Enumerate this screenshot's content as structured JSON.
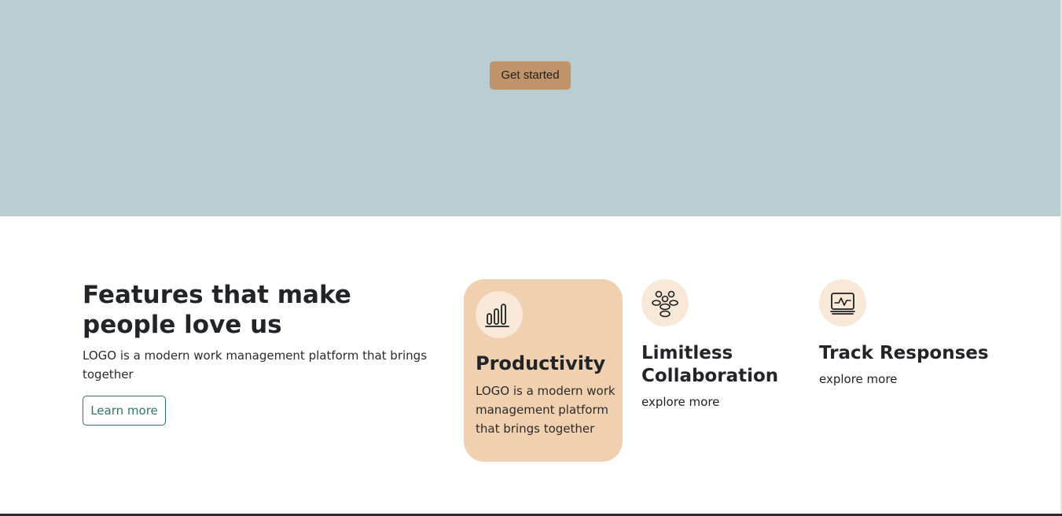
{
  "hero": {
    "cta_label": "Get started",
    "background": "#bacdd1",
    "cta_color": "#c09368"
  },
  "features": {
    "title": "Features that make people love us",
    "description": "LOGO is a modern work management platform that brings together",
    "learn_more_label": "Learn more",
    "accent": "#2f7a5a"
  },
  "cards": {
    "productivity": {
      "icon": "bar-chart-icon",
      "title": "Productivity",
      "description": "LOGO is a modern work management platform that brings together",
      "background": "#f0d0af"
    },
    "collaboration": {
      "icon": "people-group-icon",
      "title": "Limitless Collaboration",
      "link": "explore more"
    },
    "track": {
      "icon": "monitor-chart-icon",
      "title": "Track Responses",
      "link": "explore more"
    }
  }
}
